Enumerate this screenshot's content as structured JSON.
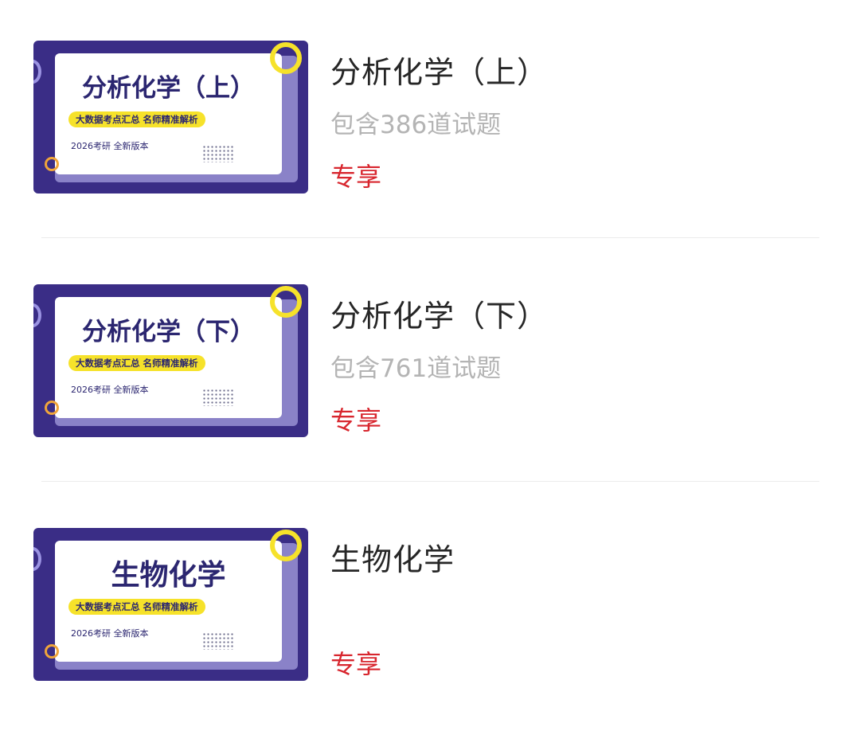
{
  "items": [
    {
      "cover": {
        "title": "分析化学（上）",
        "tagline": "大数据考点汇总 名师精准解析",
        "edition": "2026考研 全新版本"
      },
      "title": "分析化学（上）",
      "count": "包含386道试题",
      "tag": "专享"
    },
    {
      "cover": {
        "title": "分析化学（下）",
        "tagline": "大数据考点汇总 名师精准解析",
        "edition": "2026考研 全新版本"
      },
      "title": "分析化学（下）",
      "count": "包含761道试题",
      "tag": "专享"
    },
    {
      "cover": {
        "title": "生物化学",
        "tagline": "大数据考点汇总 名师精准解析",
        "edition": "2026考研 全新版本"
      },
      "title": "生物化学",
      "count": "",
      "tag": "专享"
    }
  ],
  "colors": {
    "cover_bg": "#3a2d86",
    "accent_yellow": "#f6e22a",
    "tag_red": "#d8262e",
    "count_gray": "#b4b4b4"
  }
}
